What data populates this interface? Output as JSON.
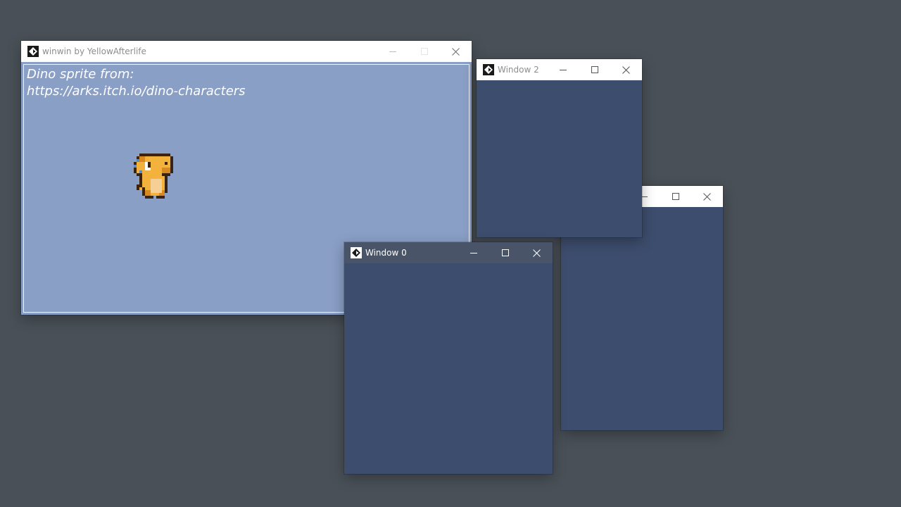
{
  "windows": {
    "main": {
      "title": "winwin by YellowAfterlife",
      "credit_line1": "Dino sprite from:",
      "credit_line2": "https://arks.itch.io/dino-characters"
    },
    "window2": {
      "title": "Window 2"
    },
    "window1": {
      "title": ""
    },
    "window0": {
      "title": "Window 0"
    }
  },
  "icons": {
    "app": "gamemaker-logo-icon",
    "minimize": "minimize-icon",
    "maximize": "maximize-icon",
    "close": "close-icon",
    "sprite": "dino-sprite"
  },
  "colors": {
    "desktop": "#495057",
    "main_client": "#8a9fc6",
    "child_client": "#3d4d6d",
    "active_titlebar": "#4a5468",
    "inactive_titlebar": "#ffffff"
  }
}
